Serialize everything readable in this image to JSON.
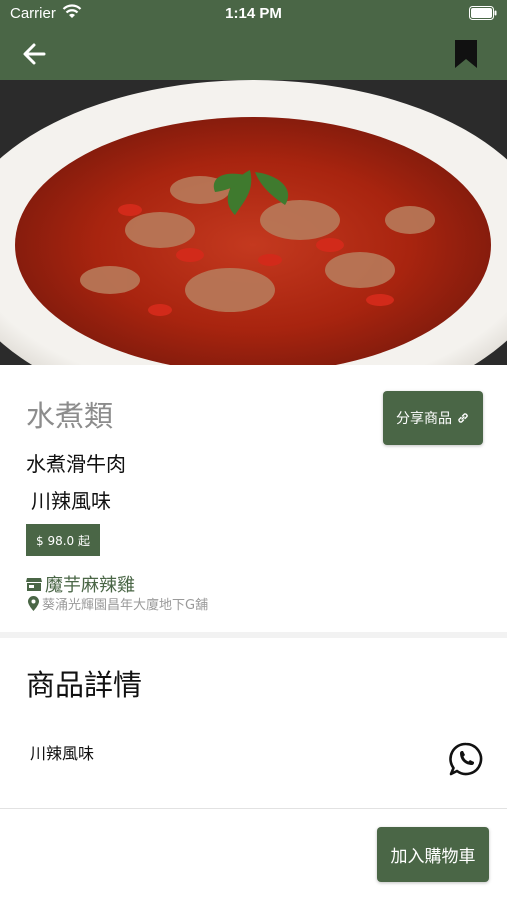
{
  "status_bar": {
    "carrier": "Carrier",
    "time": "1:14 PM"
  },
  "nav": {
    "back_icon": "arrow-left-icon",
    "bookmark_icon": "bookmark-icon"
  },
  "hero": {
    "image": "spicy boiled beef dish",
    "pages": 1,
    "current_page": 1
  },
  "product": {
    "category": "水煮類",
    "name": "水煮滑牛肉",
    "flavor": "川辣風味",
    "price": "$ 98.0 起",
    "share_label": "分享商品",
    "share_icon": "link-icon"
  },
  "shop": {
    "icon": "store-icon",
    "name": "魔芋麻辣雞",
    "address_icon": "location-pin-icon",
    "address": "葵涌光輝園昌年大廈地下G舖"
  },
  "details": {
    "title": "商品詳情",
    "description": "川辣風味",
    "whatsapp_icon": "whatsapp-icon"
  },
  "bottom": {
    "add_to_cart_label": "加入購物車"
  },
  "colors": {
    "primary": "#4a6646",
    "muted": "#8c8c8c",
    "divider": "#f2f2f2"
  }
}
